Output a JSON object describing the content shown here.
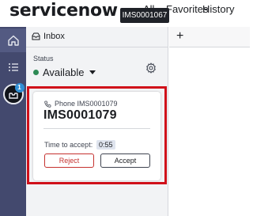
{
  "header": {
    "logo_text": "servicenow",
    "nav_all": "All",
    "nav_favorites": "Favorites",
    "nav_history": "History",
    "tooltip": "IMS0001067"
  },
  "rail": {
    "items": [
      {
        "icon": "home-icon"
      },
      {
        "icon": "list-icon"
      },
      {
        "icon": "agent-inbox-icon",
        "badge": "1"
      }
    ],
    "active_color": "#535a82",
    "background": "#43496e"
  },
  "inbox": {
    "title": "Inbox",
    "status_label": "Status",
    "status_value": "Available",
    "status_color": "#2e8a55"
  },
  "card": {
    "subtitle": "Phone IMS0001079",
    "title": "IMS0001079",
    "time_label": "Time to accept:",
    "time_value": "0:55",
    "reject_label": "Reject",
    "accept_label": "Accept",
    "highlight_color": "#d0101a"
  },
  "tabs": {
    "add_icon": "+"
  }
}
